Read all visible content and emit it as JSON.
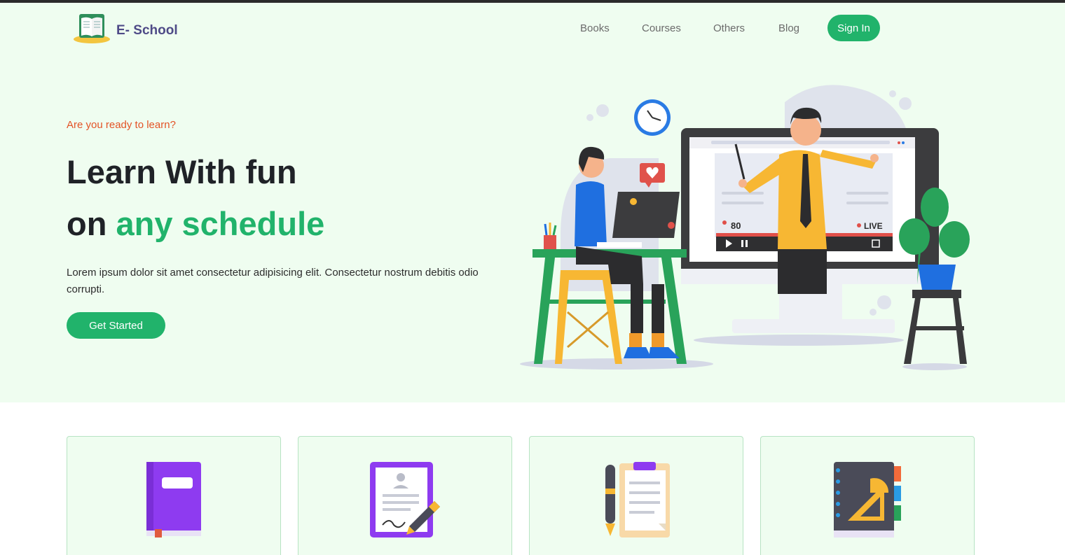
{
  "brand": {
    "name": "E- School",
    "logo_icon": "open-book-icon"
  },
  "nav": {
    "items": [
      {
        "label": "Books"
      },
      {
        "label": "Courses"
      },
      {
        "label": "Others"
      },
      {
        "label": "Blog"
      }
    ],
    "signin_label": "Sign In"
  },
  "hero": {
    "eyebrow": "Are you ready to learn?",
    "title_line1": "Learn With fun",
    "title_line2_prefix": "on ",
    "title_line2_accent": "any schedule",
    "description": "Lorem ipsum dolor sit amet consectetur adipisicing elit. Consectetur nostrum debitis odio corrupti.",
    "cta_label": "Get Started",
    "illustration": {
      "viewers": "80",
      "live_label": "LIVE"
    }
  },
  "features": [
    {
      "icon": "purple-book-icon"
    },
    {
      "icon": "signed-document-icon"
    },
    {
      "icon": "clipboard-pen-icon"
    },
    {
      "icon": "notebook-ruler-icon"
    }
  ],
  "colors": {
    "accent": "#21b36b",
    "eyebrow": "#e35326",
    "hero_bg": "#effdf0",
    "brand_text": "#4e4a87"
  }
}
